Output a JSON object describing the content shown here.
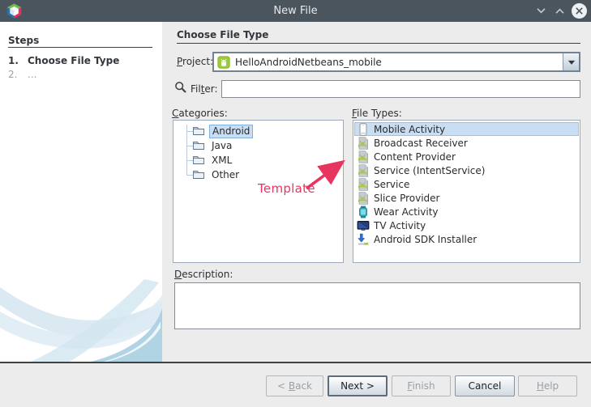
{
  "window": {
    "title": "New File"
  },
  "steps_panel": {
    "heading": "Steps",
    "items": [
      {
        "number": "1.",
        "label": "Choose File Type"
      },
      {
        "number": "2.",
        "label": "..."
      }
    ]
  },
  "main": {
    "heading": "Choose File Type",
    "project": {
      "label": {
        "mn": "P",
        "post": "roject:"
      },
      "value": "HelloAndroidNetbeans_mobile"
    },
    "filter": {
      "label": {
        "pre": "Fil",
        "mn": "t",
        "post": "er:"
      },
      "value": ""
    },
    "categories": {
      "label": {
        "mn": "C",
        "post": "ategories:"
      },
      "items": [
        {
          "label": "Android",
          "selected": true
        },
        {
          "label": "Java",
          "selected": false
        },
        {
          "label": "XML",
          "selected": false
        },
        {
          "label": "Other",
          "selected": false
        }
      ]
    },
    "file_types": {
      "label": {
        "mn": "F",
        "post": "ile Types:"
      },
      "items": [
        {
          "label": "Mobile Activity",
          "icon": "mobile-activity-icon",
          "selected": true
        },
        {
          "label": "Broadcast Receiver",
          "icon": "android-class-icon",
          "selected": false
        },
        {
          "label": "Content Provider",
          "icon": "android-class-icon",
          "selected": false
        },
        {
          "label": "Service (IntentService)",
          "icon": "android-class-icon",
          "selected": false
        },
        {
          "label": "Service",
          "icon": "android-class-icon",
          "selected": false
        },
        {
          "label": "Slice Provider",
          "icon": "android-class-icon",
          "selected": false
        },
        {
          "label": "Wear Activity",
          "icon": "wear-activity-icon",
          "selected": false
        },
        {
          "label": "TV Activity",
          "icon": "tv-activity-icon",
          "selected": false
        },
        {
          "label": "Android SDK Installer",
          "icon": "sdk-installer-icon",
          "selected": false
        }
      ]
    },
    "annotation": {
      "text": "Template",
      "color": "#e8355f"
    },
    "description": {
      "label": {
        "mn": "D",
        "post": "escription:"
      },
      "value": ""
    }
  },
  "buttons": {
    "back": {
      "pre": "< ",
      "mn": "B",
      "post": "ack",
      "enabled": false
    },
    "next": {
      "label": "Next >",
      "enabled": true,
      "focused": true
    },
    "finish": {
      "mn": "F",
      "post": "inish",
      "enabled": false
    },
    "cancel": {
      "label": "Cancel",
      "enabled": true
    },
    "help": {
      "mn": "H",
      "post": "elp",
      "enabled": false
    }
  },
  "colors": {
    "titlebar": "#4b555d",
    "selection": "#c9def2",
    "android_green": "#9ecb3b",
    "annotation_red": "#e8355f",
    "panel_bg": "#ececec"
  }
}
